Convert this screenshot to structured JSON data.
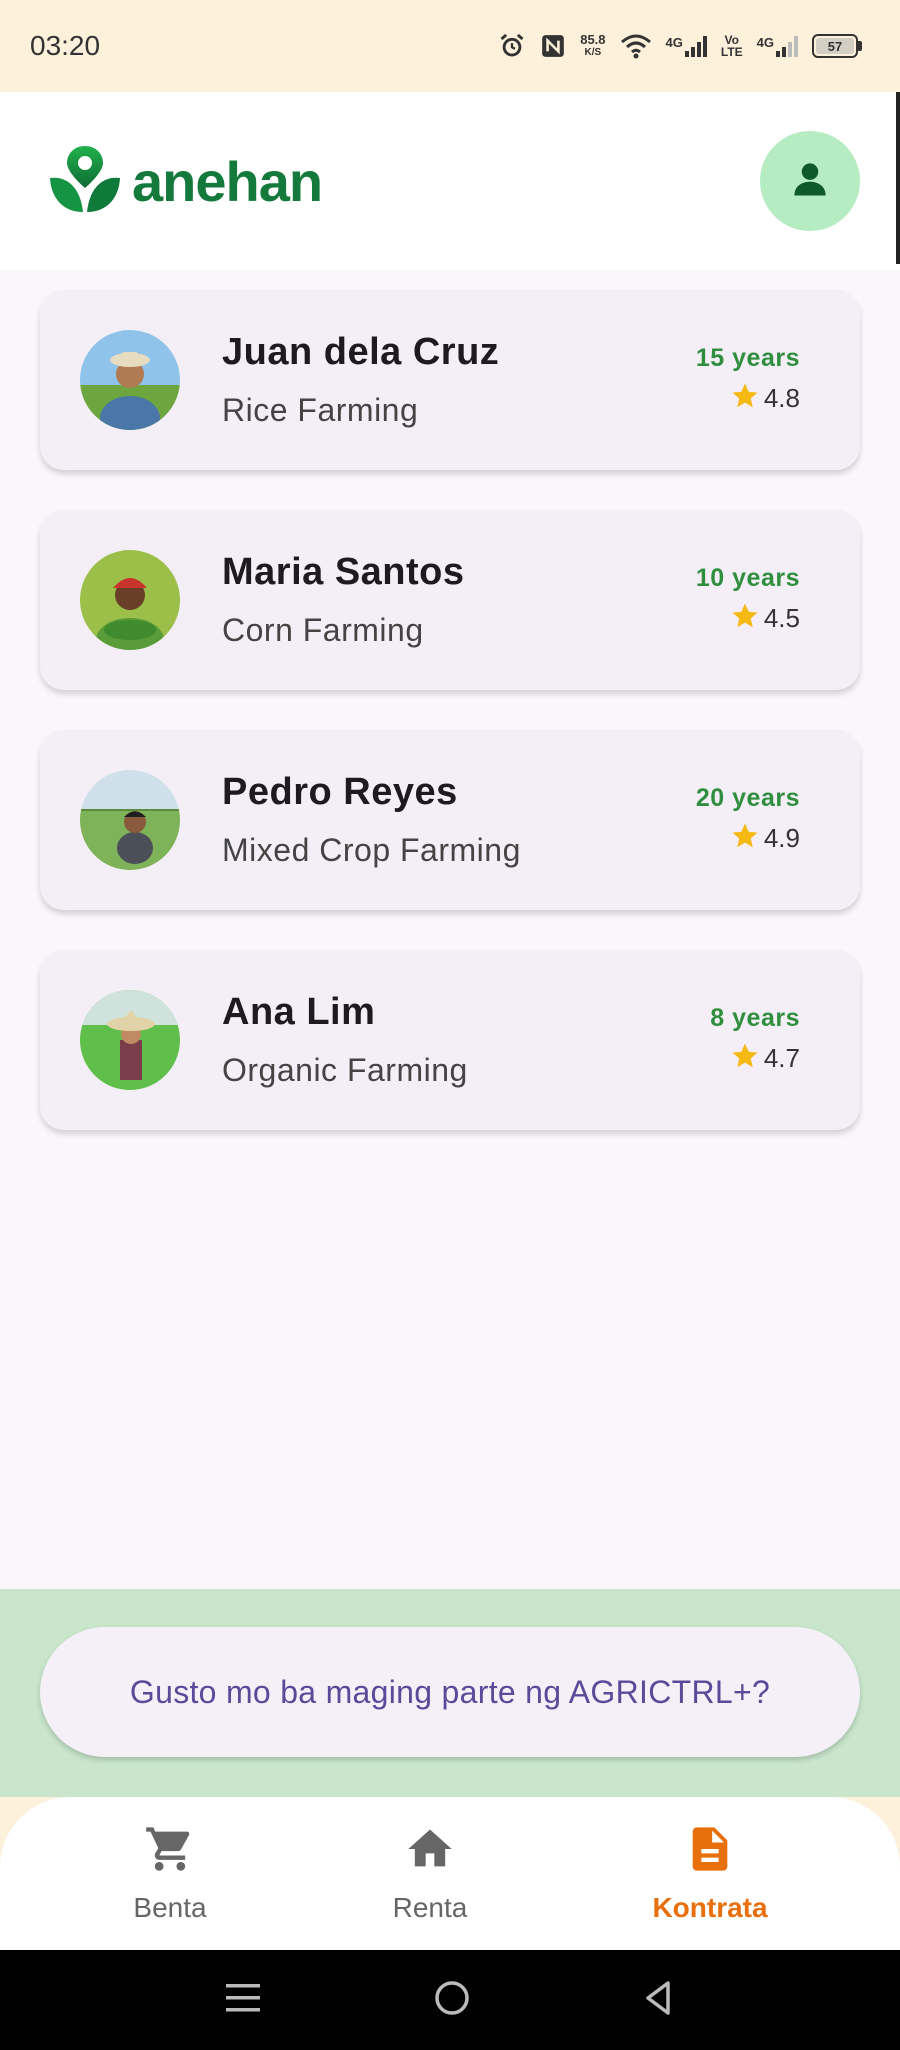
{
  "status_bar": {
    "time": "03:20",
    "net_speed_value": "85.8",
    "net_speed_unit": "K/S",
    "network_1": "4G",
    "volte_top": "Vo",
    "volte_bottom": "LTE",
    "network_2": "4G",
    "battery": "57"
  },
  "header": {
    "logo_text": "anehan",
    "brand_color": "#147a3c"
  },
  "farmers": [
    {
      "name": "Juan dela Cruz",
      "type": "Rice Farming",
      "years": "15 years",
      "rating": "4.8"
    },
    {
      "name": "Maria Santos",
      "type": "Corn Farming",
      "years": "10 years",
      "rating": "4.5"
    },
    {
      "name": "Pedro Reyes",
      "type": "Mixed Crop Farming",
      "years": "20 years",
      "rating": "4.9"
    },
    {
      "name": "Ana Lim",
      "type": "Organic Farming",
      "years": "8 years",
      "rating": "4.7"
    }
  ],
  "cta": {
    "label": "Gusto mo ba maging parte ng AGRICTRL+?"
  },
  "bottom_nav": {
    "items": [
      {
        "label": "Benta",
        "icon": "cart-icon",
        "active": false
      },
      {
        "label": "Renta",
        "icon": "home-icon",
        "active": false
      },
      {
        "label": "Kontrata",
        "icon": "document-icon",
        "active": true
      }
    ],
    "active_color": "#e8700c"
  }
}
